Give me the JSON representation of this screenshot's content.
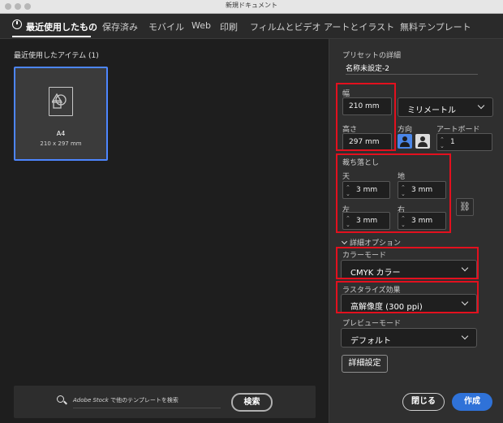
{
  "window": {
    "title": "新規ドキュメント"
  },
  "tabs": [
    {
      "label": "最近使用したもの"
    },
    {
      "label": "保存済み"
    },
    {
      "label": "モバイル"
    },
    {
      "label": "Web"
    },
    {
      "label": "印刷"
    },
    {
      "label": "フィルムとビデオ"
    },
    {
      "label": "アートとイラスト"
    },
    {
      "label": "無料テンプレート"
    }
  ],
  "recent": {
    "heading": "最近使用したアイテム  (1)",
    "items": [
      {
        "name": "A4",
        "size": "210 x 297 mm"
      }
    ]
  },
  "search": {
    "placeholder_brand": "Adobe Stock",
    "placeholder_rest": " で他のテンプレートを検索",
    "button_label": "検索"
  },
  "preset": {
    "section_title": "プリセットの詳細",
    "document_name": "名称未設定-2",
    "width_label": "幅",
    "width_value": "210 mm",
    "unit_value": "ミリメートル",
    "height_label": "高さ",
    "height_value": "297 mm",
    "orientation_label": "方向",
    "artboard_label": "アートボード",
    "artboard_value": "1",
    "bleed_label": "裁ち落とし",
    "bleed_top_label": "天",
    "bleed_top_value": "3 mm",
    "bleed_bottom_label": "地",
    "bleed_bottom_value": "3 mm",
    "bleed_left_label": "左",
    "bleed_left_value": "3 mm",
    "bleed_right_label": "右",
    "bleed_right_value": "3 mm",
    "advanced_toggle": "詳細オプション",
    "color_mode_label": "カラーモード",
    "color_mode_value": "CMYK カラー",
    "raster_label": "ラスタライズ効果",
    "raster_value": "高解像度 (300 ppi)",
    "preview_label": "プレビューモード",
    "preview_value": "デフォルト",
    "advanced_settings_button": "詳細設定"
  },
  "footer": {
    "close_label": "閉じる",
    "create_label": "作成"
  },
  "colors": {
    "accent": "#4d86ff",
    "create": "#2f72d8",
    "highlight": "#e3101e",
    "panel": "#2f2f2f",
    "background": "#1e1e1e"
  }
}
